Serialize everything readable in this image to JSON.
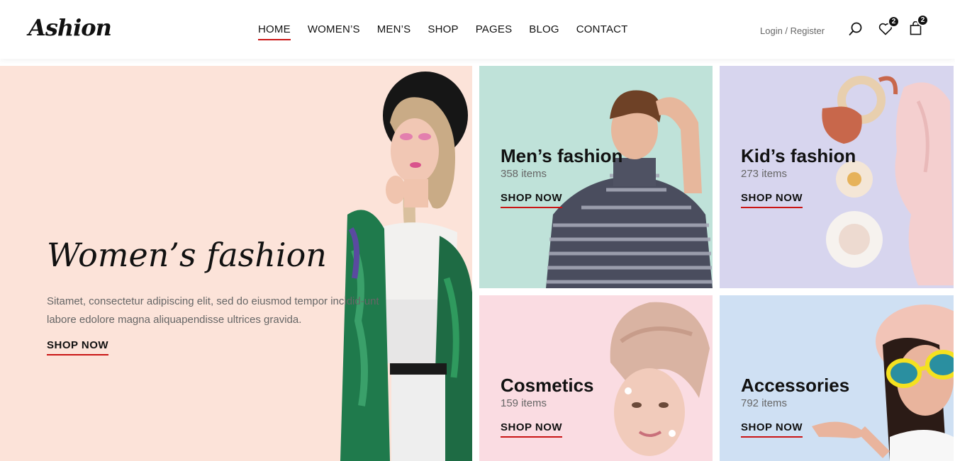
{
  "header": {
    "logo": "Ashion",
    "nav": [
      {
        "label": "HOME",
        "active": true
      },
      {
        "label": "WOMEN’S",
        "active": false
      },
      {
        "label": "MEN’S",
        "active": false
      },
      {
        "label": "SHOP",
        "active": false
      },
      {
        "label": "PAGES",
        "active": false
      },
      {
        "label": "BLOG",
        "active": false
      },
      {
        "label": "CONTACT",
        "active": false
      }
    ],
    "login": "Login",
    "separator": " / ",
    "register": "Register",
    "icons": {
      "search": "search-icon",
      "wishlist": "heart-icon",
      "cart": "shopping-bag-icon"
    },
    "wishlist_count": "2",
    "cart_count": "2"
  },
  "hero": {
    "title": "Women’s fashion",
    "description": "Sitamet, consectetur adipiscing elit, sed do eiusmod tempor incidid-unt labore edolore magna aliquapendisse ultrices gravida.",
    "cta": "SHOP NOW",
    "background": "#fce3d9"
  },
  "categories": [
    {
      "title": "Men’s fashion",
      "count": "358 items",
      "cta": "SHOP NOW",
      "background": "#bfe2d9"
    },
    {
      "title": "Kid’s fashion",
      "count": "273 items",
      "cta": "SHOP NOW",
      "background": "#d7d5ee"
    },
    {
      "title": "Cosmetics",
      "count": "159 items",
      "cta": "SHOP NOW",
      "background": "#fadce2"
    },
    {
      "title": "Accessories",
      "count": "792 items",
      "cta": "SHOP NOW",
      "background": "#cfe0f3"
    }
  ],
  "colors": {
    "accent": "#ca1515",
    "text": "#111111",
    "muted": "#666666"
  }
}
